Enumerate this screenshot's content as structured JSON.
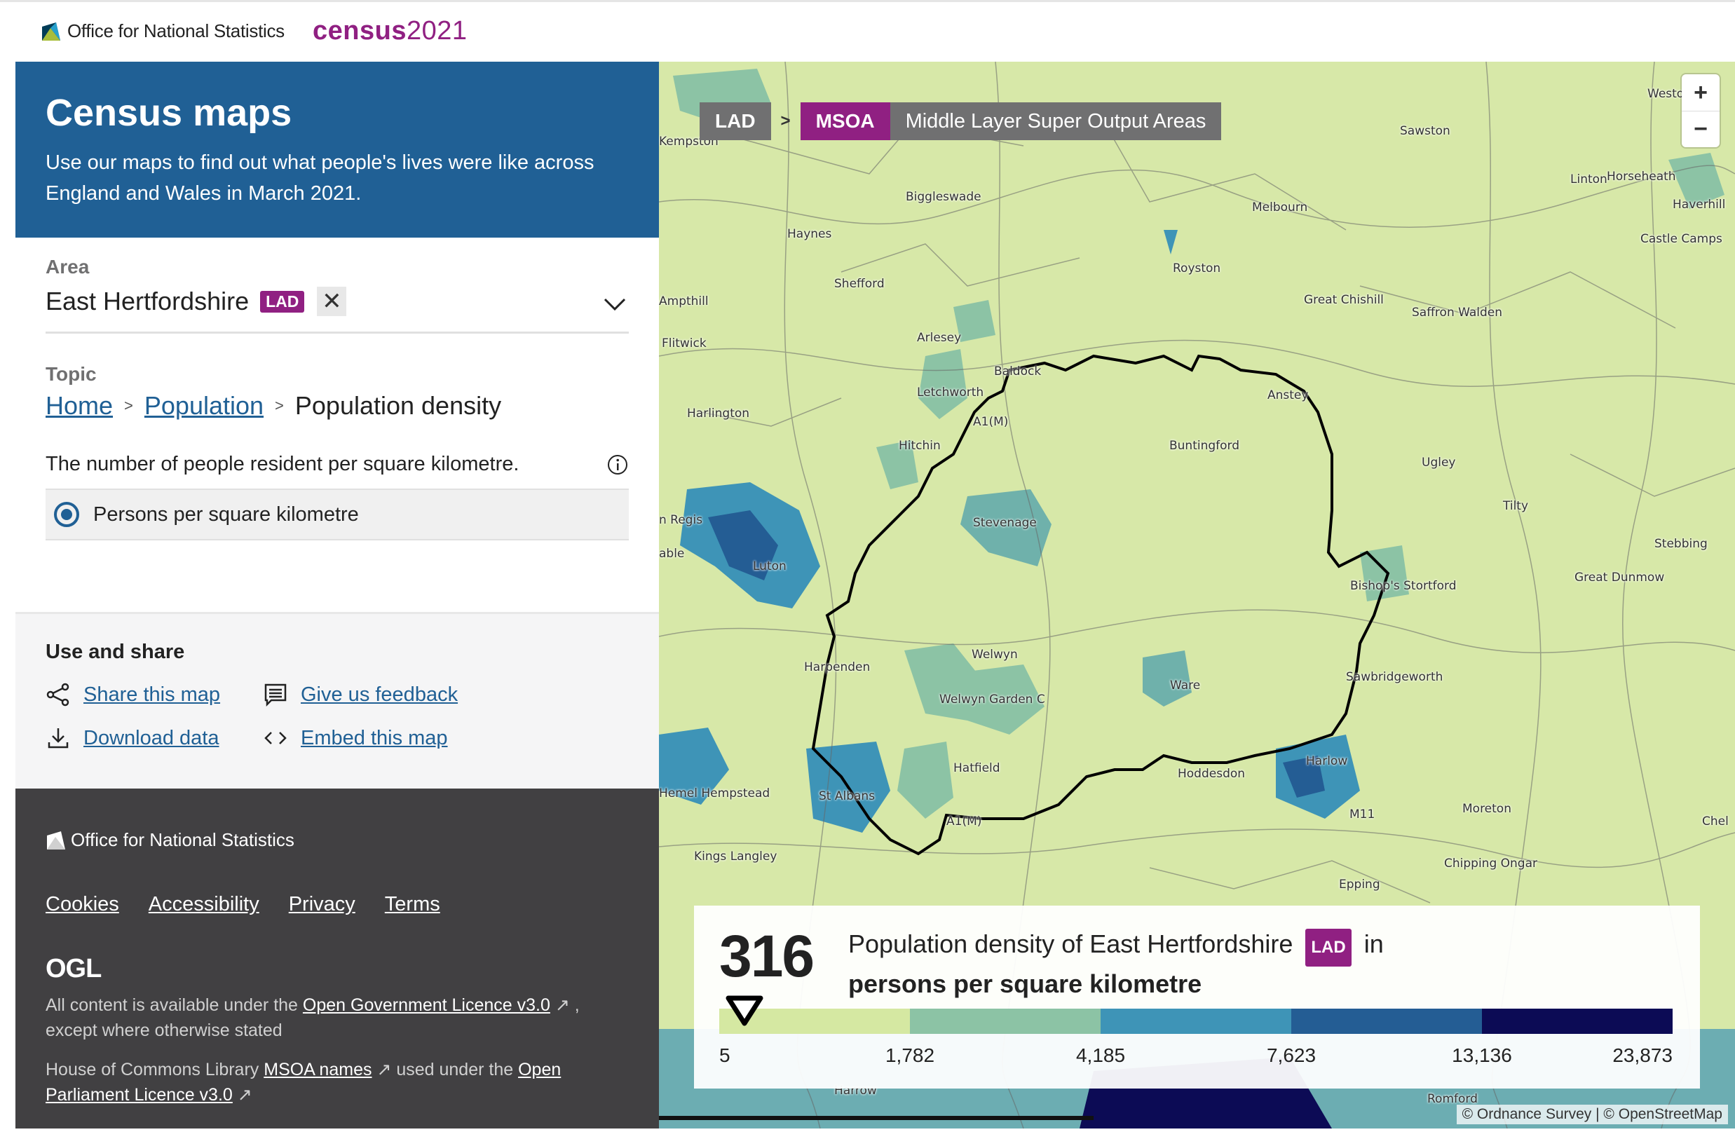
{
  "header": {
    "ons_logo_text": "Office for National Statistics",
    "census_logo_word": "census",
    "census_logo_year": "2021"
  },
  "hero": {
    "title": "Census maps",
    "subtitle": "Use our maps to find out what people's lives were like across England and Wales in March 2021."
  },
  "area": {
    "label": "Area",
    "value": "East Hertfordshire",
    "badge": "LAD",
    "clear_symbol": "✕"
  },
  "topic": {
    "label": "Topic",
    "breadcrumb": [
      "Home",
      "Population",
      "Population density"
    ],
    "sep": ">",
    "description": "The number of people resident per square kilometre.",
    "option_label": "Persons per square kilometre"
  },
  "share": {
    "heading": "Use and share",
    "share_map": "Share this map",
    "feedback": "Give us feedback",
    "download": "Download data",
    "embed": "Embed this map"
  },
  "footer": {
    "logo_text": "Office for National Statistics",
    "links": [
      "Cookies",
      "Accessibility",
      "Privacy",
      "Terms"
    ],
    "ogl": "OGL",
    "licence_prefix": "All content is available under the",
    "licence_link": "Open Government Licence v3.0",
    "licence_suffix": ", except where otherwise stated",
    "hoc_prefix": "House of Commons Library",
    "hoc_link": "MSOA names",
    "hoc_mid": "used under the",
    "hoc_link2": "Open Parliament Licence v3.0"
  },
  "map": {
    "geo_lad": "LAD",
    "geo_sep": ">",
    "geo_msoa": "MSOA",
    "geo_name": "Middle Layer Super Output Areas",
    "zoom_in": "+",
    "zoom_out": "−",
    "attribution": "© Ordnance Survey | © OpenStreetMap",
    "places": [
      "Kempston",
      "Biggleswade",
      "Sawston",
      "Weston C",
      "Linton",
      "Horseheath",
      "Haverhill",
      "Castle Camps",
      "Haynes",
      "Royston",
      "Melbourn",
      "Shefford",
      "Great Chishill",
      "Saffron Walden",
      "Ampthill",
      "Flitwick",
      "Arlesey",
      "Baldock",
      "Letchworth",
      "A1(M)",
      "Harlington",
      "Hitchin",
      "Anstey",
      "Buntingford",
      "Ugley",
      "Tilty",
      "n Regis",
      "able",
      "Luton",
      "Stevenage",
      "Bishop's Stortford",
      "Stebbing",
      "Great Dunmow",
      "Harpenden",
      "Welwyn",
      "Welwyn Garden C",
      "Ware",
      "Sawbridgeworth",
      "Hatfield",
      "Hoddesdon",
      "Harlow",
      "Hemel Hempstead",
      "St Albans",
      "A1(M)",
      "M11",
      "Moreton",
      "Chel",
      "Kings Langley",
      "Epping",
      "Chipping Ongar",
      "Harrow",
      "Romford"
    ]
  },
  "legend": {
    "value": "316",
    "title_prefix": "Population density of East Hertfordshire",
    "badge": "LAD",
    "title_suffix": "in",
    "unit": "persons per square kilometre",
    "breaks": [
      "5",
      "1,782",
      "4,185",
      "7,623",
      "13,136",
      "23,873"
    ],
    "colors": [
      "#d5e8a2",
      "#8cc3a5",
      "#3e94b7",
      "#245d94",
      "#0c0b55"
    ],
    "marker_bin": 0
  },
  "colors": {
    "brand_blue": "#206095",
    "brand_purple": "#902082",
    "footer_bg": "#414042"
  }
}
